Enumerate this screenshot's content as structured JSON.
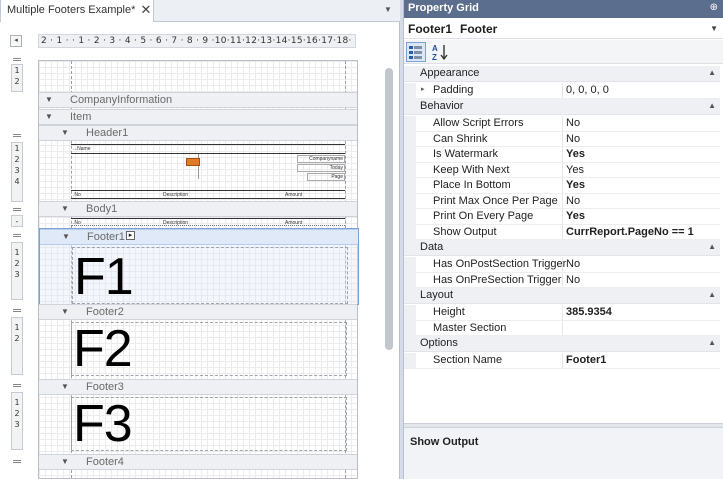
{
  "document": {
    "tab_label": "Multiple Footers Example*",
    "tab_close": "✕",
    "tab_dropdown": "▼",
    "ruler_corner": "◂",
    "h_ruler": "2 · 1 · · 1 · 2 · 3 · 4 · 5 · 6 · 7 · 8 · 9 ·10·11·12·13·14·15·16·17·18·",
    "v_rulers": {
      "top": "1\n2",
      "header": "1\n2\n3\n4",
      "body": "-",
      "footer1": "1\n2\n3",
      "footer2": "1\n2",
      "footer3": "1\n2\n3"
    },
    "bands": {
      "company": "CompanyInformation",
      "item": "Item",
      "header1": "Header1",
      "body1": "Body1",
      "footer1": "Footer1",
      "footer2": "Footer2",
      "footer3": "Footer3",
      "footer4": "Footer4"
    },
    "header_fields": {
      "name": "...Name",
      "company": "Companyname",
      "today": "Today",
      "page": "Page",
      "no": ".No",
      "description": "Description",
      "amount": "Amount"
    },
    "body_fields": {
      "no": ".No",
      "description": "Description",
      "amount": "Amount"
    },
    "big_letters": {
      "f1": "F1",
      "f2": "F2",
      "f3": "F3"
    },
    "expand_glyph": "▼",
    "smart_tag": "▸"
  },
  "property_grid": {
    "title": "Property Grid",
    "pin": "⊕",
    "selected_name": "Footer1",
    "selected_type": "Footer",
    "selector_arrow": "▼",
    "toolbar": {
      "categorized_icon": "categorized-icon",
      "alphabetical_icon": "sort-az-icon"
    },
    "categories": [
      {
        "name": "Appearance",
        "rows": [
          {
            "name": "Padding",
            "value": "0, 0, 0, 0",
            "bold": false,
            "expandable": true
          }
        ]
      },
      {
        "name": "Behavior",
        "rows": [
          {
            "name": "Allow Script Errors",
            "value": "No",
            "bold": false
          },
          {
            "name": "Can Shrink",
            "value": "No",
            "bold": false
          },
          {
            "name": "Is Watermark",
            "value": "Yes",
            "bold": true
          },
          {
            "name": "Keep With Next",
            "value": "Yes",
            "bold": false
          },
          {
            "name": "Place In Bottom",
            "value": "Yes",
            "bold": true
          },
          {
            "name": "Print Max Once Per Page",
            "value": "No",
            "bold": false
          },
          {
            "name": "Print On Every Page",
            "value": "Yes",
            "bold": true
          },
          {
            "name": "Show Output",
            "value": "CurrReport.PageNo == 1",
            "bold": true
          }
        ]
      },
      {
        "name": "Data",
        "rows": [
          {
            "name": "Has OnPostSection Trigger",
            "value": "No",
            "bold": false
          },
          {
            "name": "Has OnPreSection Trigger",
            "value": "No",
            "bold": false
          }
        ]
      },
      {
        "name": "Layout",
        "rows": [
          {
            "name": "Height",
            "value": "385.9354",
            "bold": true
          },
          {
            "name": "Master Section",
            "value": "",
            "bold": false
          }
        ]
      },
      {
        "name": "Options",
        "rows": [
          {
            "name": "Section Name",
            "value": "Footer1",
            "bold": true
          }
        ]
      }
    ],
    "description_title": "Show Output",
    "colors": {
      "title_bar": "#5c6e8d",
      "selection_border": "#7ba2d6"
    }
  }
}
